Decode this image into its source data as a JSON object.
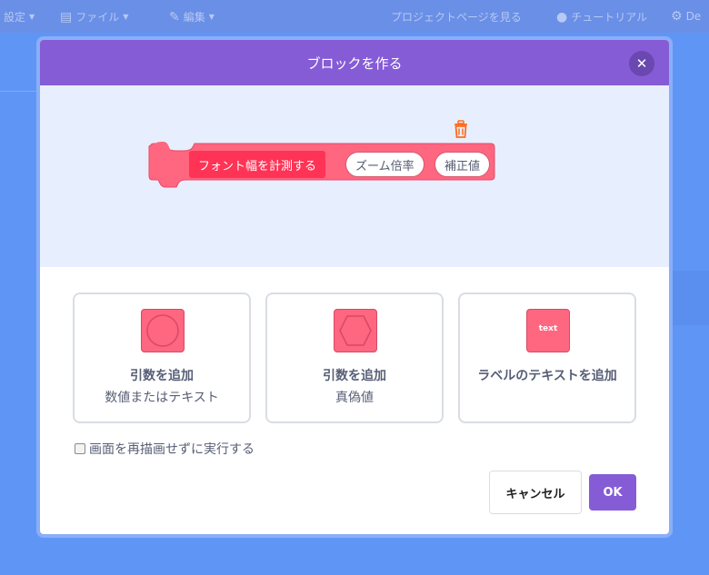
{
  "background": {
    "menubar": {
      "items": [
        {
          "label": "設定"
        },
        {
          "label": "ファイル"
        },
        {
          "label": "編集"
        },
        {
          "label": "チュートリアル"
        },
        {
          "label": "De"
        }
      ],
      "project_link": "プロジェクトページを見る"
    }
  },
  "modal": {
    "title": "ブロックを作る",
    "close_icon": "close-icon",
    "preview": {
      "block_label": "フォント幅を計測する",
      "args": [
        "ズーム倍率",
        "補正値"
      ],
      "trash_icon": "trash-icon",
      "block_color": "#ff6680",
      "label_color": "#ff3355"
    },
    "options": [
      {
        "title": "引数を追加",
        "subtitle": "数値またはテキスト",
        "icon": "circle-input-icon"
      },
      {
        "title": "引数を追加",
        "subtitle": "真偽値",
        "icon": "boolean-input-icon"
      },
      {
        "title": "ラベルのテキストを追加",
        "subtitle": "",
        "icon": "text-label-icon",
        "icon_text": "text"
      }
    ],
    "checkbox": {
      "label": "画面を再描画せずに実行する",
      "checked": false
    },
    "buttons": {
      "cancel": "キャンセル",
      "ok": "OK"
    },
    "accent_color": "#855cd6"
  }
}
